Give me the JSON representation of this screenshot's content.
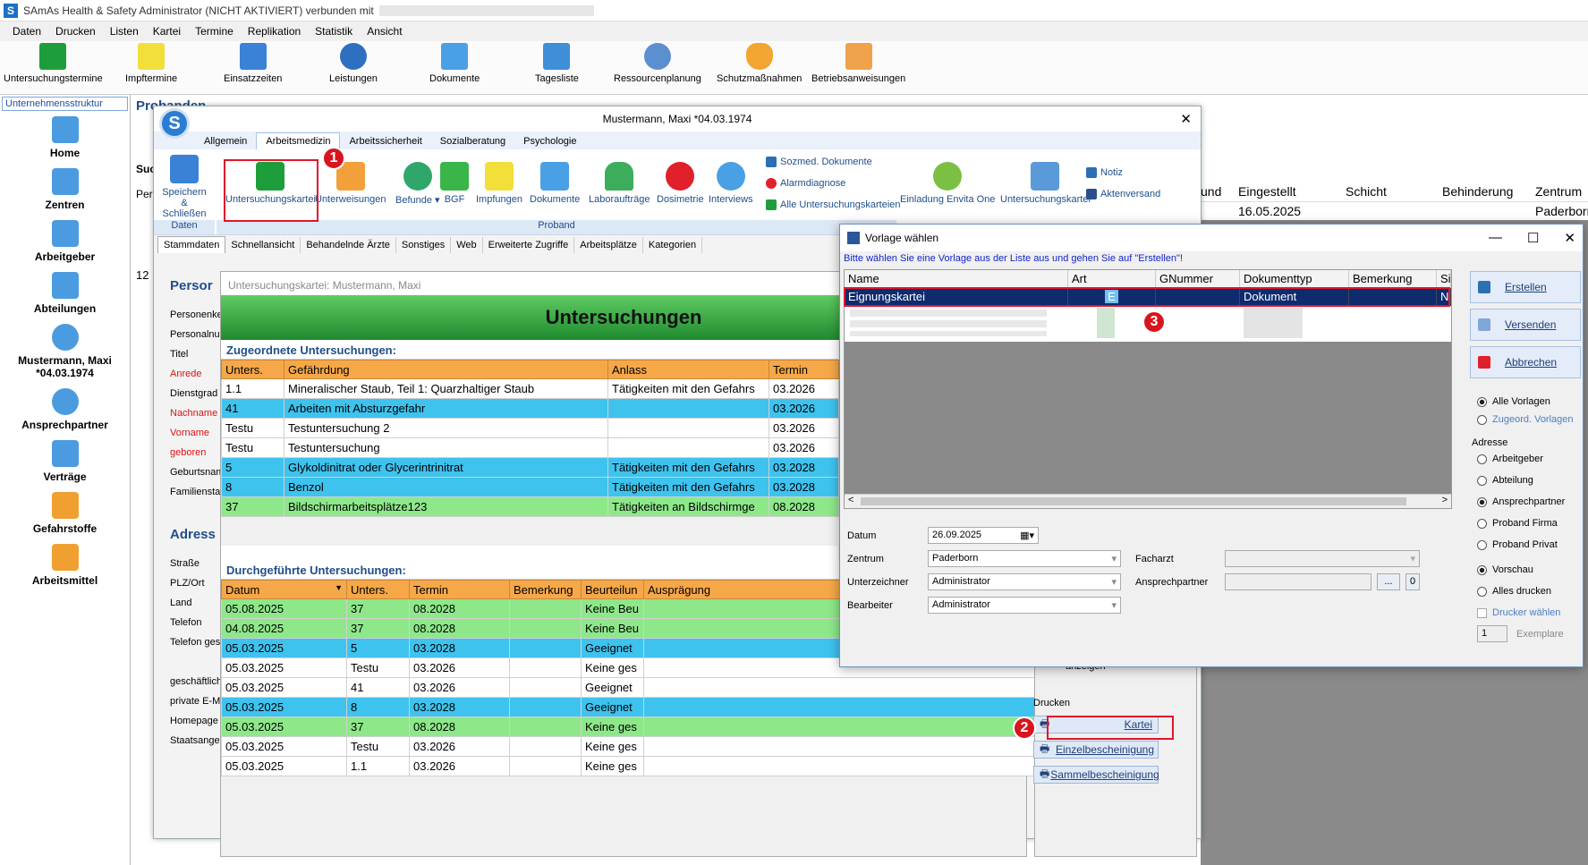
{
  "app": {
    "title": "SAmAs Health & Safety Administrator (NICHT AKTIVIERT)  verbunden mit"
  },
  "menu": [
    "Daten",
    "Drucken",
    "Listen",
    "Kartei",
    "Termine",
    "Replikation",
    "Statistik",
    "Ansicht"
  ],
  "toolbar": [
    "Untersuchungstermine",
    "Impftermine",
    "Einsatzzeiten",
    "Leistungen",
    "Dokumente",
    "Tagesliste",
    "Ressourcenplanung",
    "Schutzmaßnahmen",
    "Betriebsanweisungen"
  ],
  "left": {
    "header": "Unternehmensstruktur",
    "items": [
      "Home",
      "Zentren",
      "Arbeitgeber",
      "Abteilungen",
      "Mustermann, Maxi *04.03.1974",
      "Ansprechpartner",
      "Verträge",
      "Gefahrstoffe",
      "Arbeitsmittel"
    ]
  },
  "bg": {
    "heading": "Probanden",
    "col_su": "Suc",
    "col_per": "Per",
    "num": "12",
    "cols": [
      "und",
      "Eingestellt",
      "Schicht",
      "Behinderung",
      "Zentrum"
    ],
    "row": {
      "eingestellt": "16.05.2025",
      "zentrum": "Paderborn"
    }
  },
  "proband": {
    "title": "Mustermann, Maxi *04.03.1974",
    "tabs": [
      "Allgemein",
      "Arbeitsmedizin",
      "Arbeitssicherheit",
      "Sozialberatung",
      "Psychologie"
    ],
    "ribbon": {
      "save": "Speichern & Schließen",
      "group_daten": "Daten",
      "group_proband": "Proband",
      "buttons": [
        "Untersuchungskartei",
        "Unterweisungen",
        "Befunde",
        "BGF",
        "Impfungen",
        "Dokumente",
        "Laboraufträge",
        "Dosimetrie",
        "Interviews"
      ],
      "small": [
        "Sozmed. Dokumente",
        "Alarmdiagnose",
        "Alle Untersuchungskarteien"
      ],
      "envita": "Einladung Envita One",
      "kartei2": "Untersuchungskartei",
      "notiz": "Notiz",
      "akten": "Aktenversand"
    },
    "subtabs": [
      "Stammdaten",
      "Schnellansicht",
      "Behandelnde Ärzte",
      "Sonstiges",
      "Web",
      "Erweiterte Zugriffe",
      "Arbeitsplätze",
      "Kategorien"
    ],
    "sec1": "Persor",
    "sec2": "Adress",
    "fields1": [
      "Personenke",
      "Personalnum",
      "Titel",
      "Anrede",
      "Dienstgrad",
      "Nachname",
      "Vorname",
      "geboren",
      "Geburtsnam",
      "Familienstan"
    ],
    "fields2": [
      "Straße",
      "PLZ/Ort",
      "Land",
      "Telefon",
      "Telefon ges",
      "geschäftlich",
      "private E-Ma",
      "Homepage",
      "Staatsangel"
    ]
  },
  "kartei": {
    "header": "Untersuchungskartei: Mustermann, Maxi",
    "banner": "Untersuchungen",
    "assigned_label": "Zugeordnete Untersuchungen:",
    "assigned_cols": [
      "Unters.",
      "Gefährdung",
      "Anlass",
      "Termin"
    ],
    "assigned_rows": [
      {
        "c": "w",
        "u": "1.1",
        "g": "Mineralischer Staub, Teil 1: Quarzhaltiger Staub",
        "a": "Tätigkeiten mit den Gefahrs",
        "t": "03.2026"
      },
      {
        "c": "b",
        "u": "41",
        "g": "Arbeiten mit Absturzgefahr",
        "a": "",
        "t": "03.2026"
      },
      {
        "c": "w",
        "u": "Testu",
        "g": "Testuntersuchung 2",
        "a": "",
        "t": "03.2026"
      },
      {
        "c": "w",
        "u": "Testu",
        "g": "Testuntersuchung",
        "a": "",
        "t": "03.2026"
      },
      {
        "c": "b",
        "u": "5",
        "g": "Glykoldinitrat oder Glycerintrinitrat",
        "a": "Tätigkeiten mit den Gefahrs",
        "t": "03.2028"
      },
      {
        "c": "b",
        "u": "8",
        "g": "Benzol",
        "a": "Tätigkeiten mit den Gefahrs",
        "t": "03.2028"
      },
      {
        "c": "g",
        "u": "37",
        "g": "Bildschirmarbeitsplätze123",
        "a": "Tätigkeiten an Bildschirmge",
        "t": "08.2028"
      }
    ],
    "done_label": "Durchgeführte Untersuchungen:",
    "done_cols": [
      "Datum",
      "Unters.",
      "Termin",
      "Bemerkung",
      "Beurteilun",
      "Ausprägung"
    ],
    "done_rows": [
      {
        "c": "g",
        "d": "05.08.2025",
        "u": "37",
        "t": "08.2028",
        "b": "",
        "r": "Keine Beu"
      },
      {
        "c": "g",
        "d": "04.08.2025",
        "u": "37",
        "t": "08.2028",
        "b": "",
        "r": "Keine Beu"
      },
      {
        "c": "b",
        "d": "05.03.2025",
        "u": "5",
        "t": "03.2028",
        "b": "",
        "r": "Geeignet"
      },
      {
        "c": "w",
        "d": "05.03.2025",
        "u": "Testu",
        "t": "03.2026",
        "b": "",
        "r": "Keine ges"
      },
      {
        "c": "w",
        "d": "05.03.2025",
        "u": "41",
        "t": "03.2026",
        "b": "",
        "r": "Geeignet"
      },
      {
        "c": "b",
        "d": "05.03.2025",
        "u": "8",
        "t": "03.2028",
        "b": "",
        "r": "Geeignet"
      },
      {
        "c": "g",
        "d": "05.03.2025",
        "u": "37",
        "t": "08.2028",
        "b": "",
        "r": "Keine ges"
      },
      {
        "c": "w",
        "d": "05.03.2025",
        "u": "Testu",
        "t": "03.2026",
        "b": "",
        "r": "Keine ges"
      },
      {
        "c": "w",
        "d": "05.03.2025",
        "u": "1.1",
        "t": "03.2026",
        "b": "",
        "r": "Keine ges"
      }
    ],
    "anzeigen": "anzeigen",
    "drucken": {
      "label": "Drucken",
      "buttons": [
        "Kartei",
        "Einzelbescheinigung",
        "Sammelbescheinigung"
      ]
    }
  },
  "dialog": {
    "title": "Vorlage wählen",
    "hint": "Bitte wählen Sie eine Vorlage aus der Liste aus und gehen Sie auf \"Erstellen\"!",
    "cols": [
      "Name",
      "Art",
      "GNummer",
      "Dokumenttyp",
      "Bemerkung",
      "Si"
    ],
    "row": {
      "name": "Eignungskartei",
      "art": "E",
      "gnr": "",
      "typ": "Dokument",
      "bem": "",
      "si": "N"
    },
    "buttons": [
      "Erstellen",
      "Versenden",
      "Abbrechen"
    ],
    "vorlagen": [
      "Alle Vorlagen",
      "Zugeord. Vorlagen"
    ],
    "adresse_label": "Adresse",
    "adresse": [
      "Arbeitgeber",
      "Abteilung",
      "Ansprechpartner",
      "Proband Firma",
      "Proband Privat"
    ],
    "print": [
      "Vorschau",
      "Alles drucken"
    ],
    "drucker": "Drucker wählen",
    "copies": "1",
    "exemplare": "Exemplare",
    "labels": {
      "datum": "Datum",
      "zentrum": "Zentrum",
      "unterz": "Unterzeichner",
      "bearb": "Bearbeiter",
      "facharzt": "Facharzt",
      "ansp": "Ansprechpartner"
    },
    "values": {
      "datum": "26.09.2025",
      "zentrum": "Paderborn",
      "unterz": "Administrator",
      "bearb": "Administrator",
      "ansp_count": "0"
    }
  },
  "markers": [
    "1",
    "2",
    "3"
  ],
  "colors": {
    "accent": "#1b6fc4",
    "red": "#e0162b",
    "orange": "#f6a848",
    "blue_row": "#3ec3ef",
    "green_row": "#8ee88a",
    "selection": "#0e2b6e"
  }
}
